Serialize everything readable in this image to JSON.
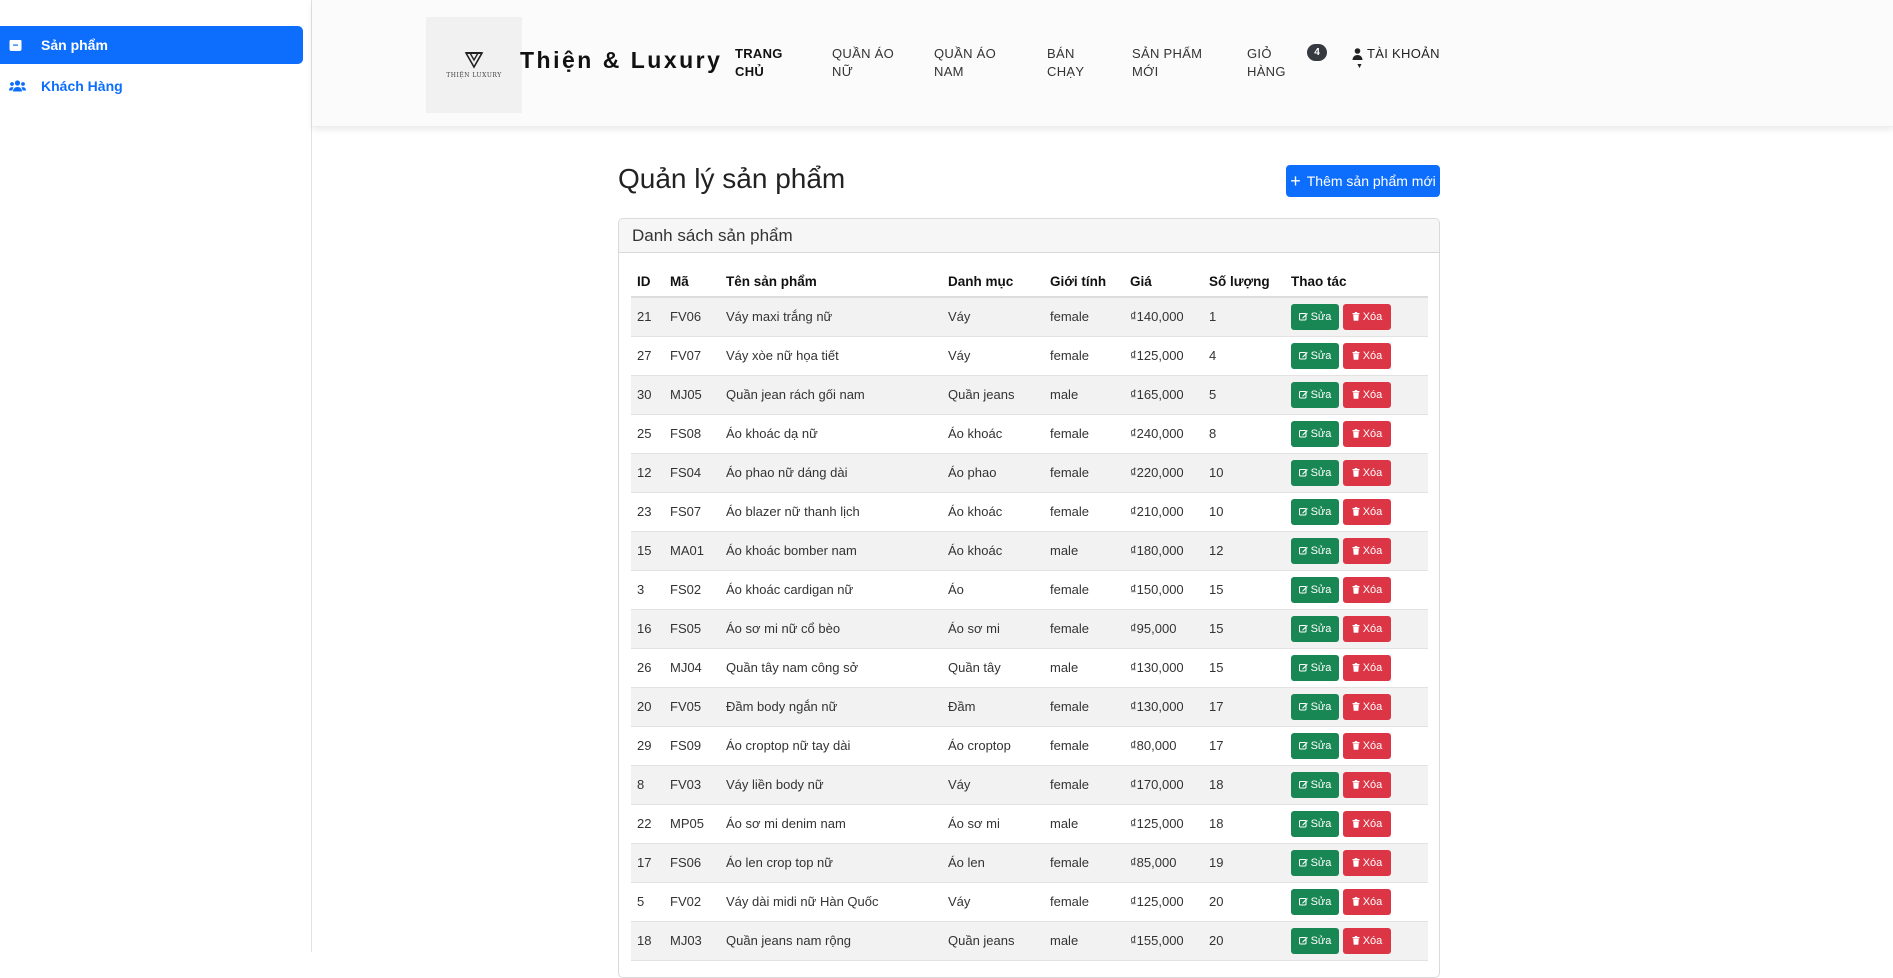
{
  "sidebar": {
    "items": [
      {
        "label": "Sản phẩm",
        "icon": "box-icon"
      },
      {
        "label": "Khách Hàng",
        "icon": "users-icon"
      }
    ]
  },
  "header": {
    "logo_text": "THIỆN LUXURY",
    "brand": "Thiện & Luxury",
    "nav": [
      {
        "line1": "TRANG",
        "line2": "CHỦ"
      },
      {
        "line1": "QUẦN ÁO",
        "line2": "NỮ"
      },
      {
        "line1": "QUẦN ÁO",
        "line2": "NAM"
      },
      {
        "line1": "BÁN",
        "line2": "CHẠY"
      },
      {
        "line1": "SẢN PHẨM",
        "line2": "MỚI"
      },
      {
        "line1": "GIỎ",
        "line2": "HÀNG"
      }
    ],
    "cart_count": "4",
    "account_label": "TÀI KHOẢN"
  },
  "main": {
    "title": "Quản lý sản phẩm",
    "add_button": "Thêm sản phẩm mới",
    "card_title": "Danh sách sản phẩm",
    "columns": [
      "ID",
      "Mã",
      "Tên sản phẩm",
      "Danh mục",
      "Giới tính",
      "Giá",
      "Số lượng",
      "Thao tác"
    ],
    "edit_label": "Sửa",
    "delete_label": "Xóa",
    "rows": [
      [
        "21",
        "FV06",
        "Váy maxi trắng nữ",
        "Váy",
        "female",
        "₫140,000",
        "1"
      ],
      [
        "27",
        "FV07",
        "Váy xòe nữ họa tiết",
        "Váy",
        "female",
        "₫125,000",
        "4"
      ],
      [
        "30",
        "MJ05",
        "Quần jean rách gối nam",
        "Quần jeans",
        "male",
        "₫165,000",
        "5"
      ],
      [
        "25",
        "FS08",
        "Áo khoác dạ nữ",
        "Áo khoác",
        "female",
        "₫240,000",
        "8"
      ],
      [
        "12",
        "FS04",
        "Áo phao nữ dáng dài",
        "Áo phao",
        "female",
        "₫220,000",
        "10"
      ],
      [
        "23",
        "FS07",
        "Áo blazer nữ thanh lịch",
        "Áo khoác",
        "female",
        "₫210,000",
        "10"
      ],
      [
        "15",
        "MA01",
        "Áo khoác bomber nam",
        "Áo khoác",
        "male",
        "₫180,000",
        "12"
      ],
      [
        "3",
        "FS02",
        "Áo khoác cardigan nữ",
        "Áo",
        "female",
        "₫150,000",
        "15"
      ],
      [
        "16",
        "FS05",
        "Áo sơ mi nữ cổ bèo",
        "Áo sơ mi",
        "female",
        "₫95,000",
        "15"
      ],
      [
        "26",
        "MJ04",
        "Quần tây nam công sở",
        "Quần tây",
        "male",
        "₫130,000",
        "15"
      ],
      [
        "20",
        "FV05",
        "Đầm body ngắn nữ",
        "Đầm",
        "female",
        "₫130,000",
        "17"
      ],
      [
        "29",
        "FS09",
        "Áo croptop nữ tay dài",
        "Áo croptop",
        "female",
        "₫80,000",
        "17"
      ],
      [
        "8",
        "FV03",
        "Váy liền body nữ",
        "Váy",
        "female",
        "₫170,000",
        "18"
      ],
      [
        "22",
        "MP05",
        "Áo sơ mi denim nam",
        "Áo sơ mi",
        "male",
        "₫125,000",
        "18"
      ],
      [
        "17",
        "FS06",
        "Áo len crop top nữ",
        "Áo len",
        "female",
        "₫85,000",
        "19"
      ],
      [
        "5",
        "FV02",
        "Váy dài midi nữ Hàn Quốc",
        "Váy",
        "female",
        "₫125,000",
        "20"
      ],
      [
        "18",
        "MJ03",
        "Quần jeans nam rộng",
        "Quần jeans",
        "male",
        "₫155,000",
        "20"
      ]
    ]
  },
  "colors": {
    "primary": "#0d6efd",
    "edit": "#198754",
    "delete": "#dc3545",
    "badge": "#343a40"
  }
}
